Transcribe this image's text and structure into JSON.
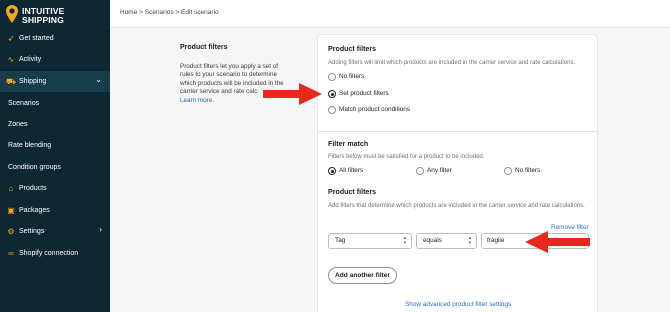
{
  "logo": {
    "line1": "INTUITIVE",
    "line2": "SHIPPING"
  },
  "sidebar": {
    "items": [
      {
        "label": "Get started",
        "icon": "rocket-icon",
        "glyph": "➶"
      },
      {
        "label": "Activity",
        "icon": "activity-icon",
        "glyph": "∿"
      },
      {
        "label": "Shipping",
        "icon": "truck-icon",
        "glyph": "⛟"
      },
      {
        "label": "Scenarios"
      },
      {
        "label": "Zones"
      },
      {
        "label": "Rate blending"
      },
      {
        "label": "Condition groups"
      },
      {
        "label": "Products",
        "icon": "tag-icon",
        "glyph": "⌂"
      },
      {
        "label": "Packages",
        "icon": "package-icon",
        "glyph": "▣"
      },
      {
        "label": "Settings",
        "icon": "gear-icon",
        "glyph": "⚙"
      },
      {
        "label": "Shopify connection",
        "icon": "link-icon",
        "glyph": "∞"
      }
    ]
  },
  "breadcrumb": "Home > Scenarios > Edit scenario",
  "left": {
    "title": "Product filters",
    "text": "Product filters let you apply a set of rules to your scenario to determine which products will be included in the carrier service and rate calc",
    "link": "Learn more."
  },
  "product_filters": {
    "title": "Product filters",
    "help": "Adding filters will limit which products are included in the carrier service and rate calculations.",
    "options": [
      "No filters",
      "Set product filters",
      "Match product conditions"
    ],
    "selected": "Set product filters"
  },
  "filter_match": {
    "title": "Filter match",
    "help": "Filters below must be satisfied for a product to be included.",
    "options": [
      "All filters",
      "Any filter",
      "No filters"
    ],
    "selected": "All filters"
  },
  "filters_section": {
    "title": "Product filters",
    "help": "Add filters that determine which products are included in the carrier service and rate calculations.",
    "remove_label": "Remove filter",
    "field_value": "Tag",
    "operator_value": "equals",
    "text_value": "fragile",
    "add_label": "Add another filter",
    "advanced_label": "Show advanced product filter settings"
  },
  "colors": {
    "sidebar": "#0d2733",
    "accent": "#f5a623",
    "arrow": "#e8271f",
    "link": "#2c6ecb"
  }
}
